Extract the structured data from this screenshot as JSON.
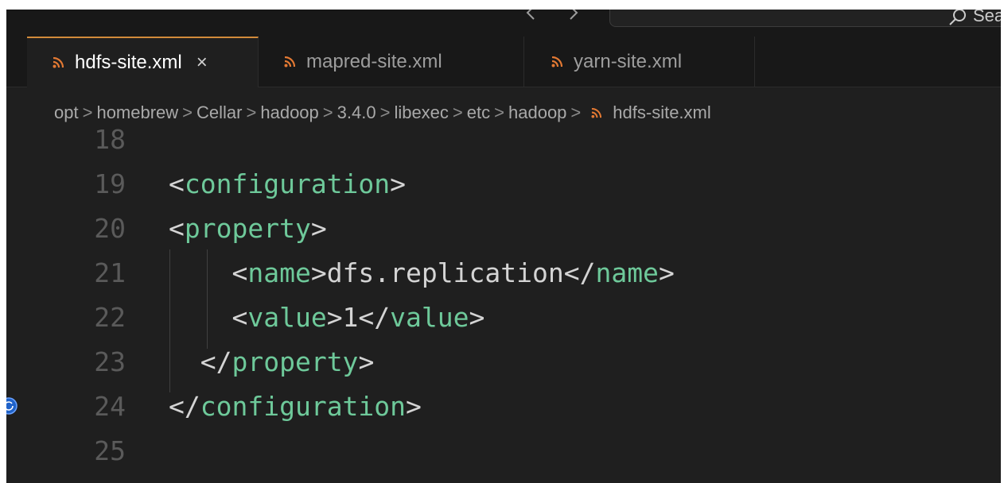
{
  "search": {
    "text": "Sea"
  },
  "tabs": [
    {
      "label": "hdfs-site.xml",
      "active": true,
      "close": "×"
    },
    {
      "label": "mapred-site.xml",
      "active": false
    },
    {
      "label": "yarn-site.xml",
      "active": false
    }
  ],
  "breadcrumb": {
    "parts": [
      "opt",
      "homebrew",
      "Cellar",
      "hadoop",
      "3.4.0",
      "libexec",
      "etc",
      "hadoop"
    ],
    "separator": ">",
    "file": "hdfs-site.xml"
  },
  "editor": {
    "lines": [
      {
        "number": "18",
        "tokens": []
      },
      {
        "number": "19",
        "tokens": [
          [
            "pn",
            "<"
          ],
          [
            "tg",
            "configuration"
          ],
          [
            "pn",
            ">"
          ]
        ]
      },
      {
        "number": "20",
        "tokens": [
          [
            "pn",
            "<"
          ],
          [
            "tg",
            "property"
          ],
          [
            "pn",
            ">"
          ]
        ]
      },
      {
        "number": "21",
        "tokens": [
          [
            "pn",
            "    <"
          ],
          [
            "tg",
            "name"
          ],
          [
            "pn",
            ">dfs.replication</"
          ],
          [
            "tg",
            "name"
          ],
          [
            "pn",
            ">"
          ]
        ]
      },
      {
        "number": "22",
        "tokens": [
          [
            "pn",
            "    <"
          ],
          [
            "tg",
            "value"
          ],
          [
            "pn",
            ">1</"
          ],
          [
            "tg",
            "value"
          ],
          [
            "pn",
            ">"
          ]
        ]
      },
      {
        "number": "23",
        "tokens": [
          [
            "pn",
            "  </"
          ],
          [
            "tg",
            "property"
          ],
          [
            "pn",
            ">"
          ]
        ]
      },
      {
        "number": "24",
        "tokens": [
          [
            "pn",
            "</"
          ],
          [
            "tg",
            "configuration"
          ],
          [
            "pn",
            ">"
          ]
        ]
      },
      {
        "number": "25",
        "tokens": []
      }
    ]
  },
  "colors": {
    "tag": "#6ec99a",
    "punctuation": "#d4d4d4",
    "line_number": "#5a5a5a",
    "active_tab_accent": "#d18a3a",
    "xml_icon": "#e37933"
  },
  "icons": {
    "file": "rss-xml-icon",
    "back": "arrow-left-icon",
    "forward": "arrow-right-icon",
    "search": "search-icon"
  }
}
